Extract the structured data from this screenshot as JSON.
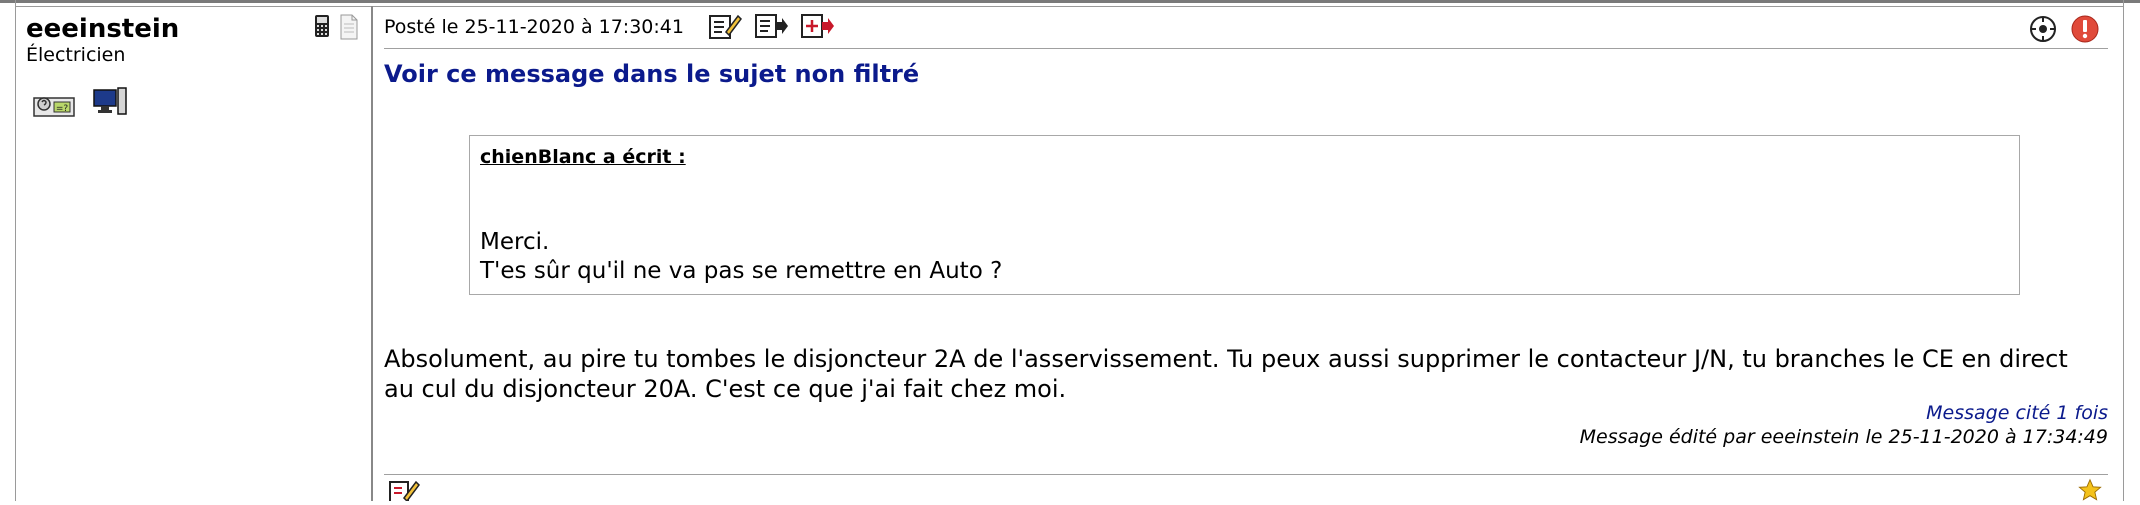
{
  "post": {
    "author": "eeeinstein",
    "role": "Électricien",
    "posted_text": "Posté le 25-11-2020 à 17:30:41",
    "view_unfiltered": "Voir ce message dans le sujet non filtré",
    "quote": {
      "header": "chienBlanc a écrit :",
      "line1": "Merci.",
      "line2": "T'es sûr qu'il ne va pas se remettre en Auto ?"
    },
    "body": "Absolument, au pire tu tombes le disjoncteur 2A de l'asservissement. Tu peux aussi supprimer le contacteur J/N, tu branches le CE en direct au cul du disjoncteur 20A. C'est ce que j'ai fait chez moi.",
    "cited": "Message cité 1 fois",
    "edited": "Message édité par eeeinstein le 25-11-2020 à 17:34:49"
  },
  "icons": {
    "phone": "phone-icon",
    "document": "document-icon",
    "profile_card": "profile-card-icon",
    "computer": "computer-icon",
    "edit": "edit-icon",
    "quote": "quote-icon",
    "multi_quote": "multi-quote-icon",
    "report_view": "view-icon",
    "alert": "alert-icon",
    "star": "star-icon"
  },
  "colors": {
    "link_blue": "#0b1a8c",
    "alert_red": "#e04a3a",
    "star_yellow": "#f4c21b"
  }
}
